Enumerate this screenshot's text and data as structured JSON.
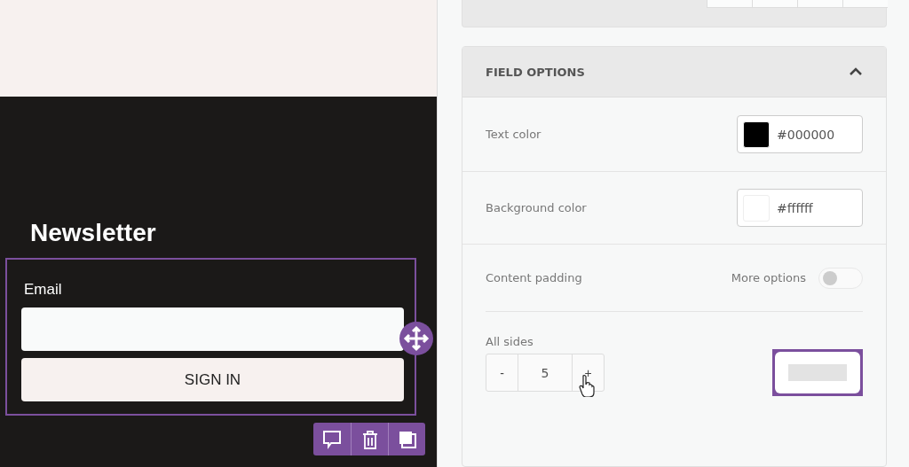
{
  "canvas": {
    "heading": "Newsletter",
    "form": {
      "selected": true,
      "field_label": "Email",
      "submit_label": "SIGN IN"
    }
  },
  "element_toolbar": [
    {
      "kind": "comment"
    },
    {
      "kind": "delete"
    },
    {
      "kind": "duplicate"
    }
  ],
  "panel": {
    "section": {
      "title": "FIELD OPTIONS",
      "expanded": true,
      "rows": [
        {
          "kind": "color",
          "label": "Text color",
          "value": "#000000",
          "color": "#000000"
        },
        {
          "kind": "color",
          "label": "Background color",
          "value": "#ffffff",
          "color": "#ffffff"
        },
        {
          "kind": "toggle",
          "label": "Content padding",
          "toggle_label": "More options",
          "on": false
        },
        {
          "kind": "stepper",
          "label": "All sides",
          "minus": "-",
          "value": "5",
          "plus": "+"
        }
      ]
    }
  }
}
